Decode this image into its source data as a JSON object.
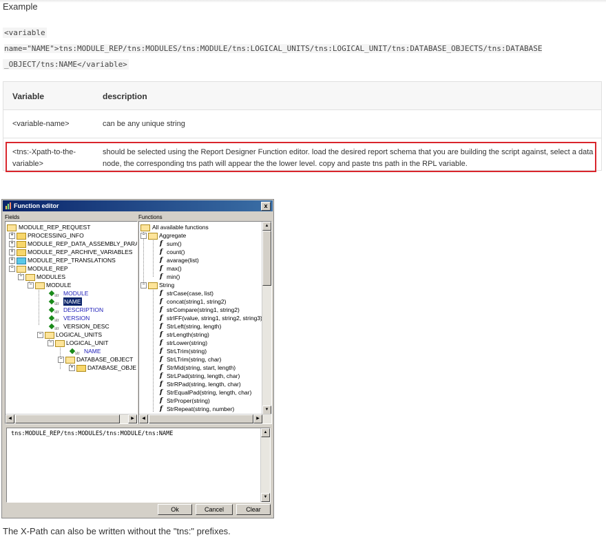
{
  "heading": "Example",
  "code_lines": [
    "<variable",
    "name=\"NAME\">tns:MODULE_REP/tns:MODULES/tns:MODULE/tns:LOGICAL_UNITS/tns:LOGICAL_UNIT/tns:DATABASE_OBJECTS/tns:DATABASE",
    "_OBJECT/tns:NAME</variable>"
  ],
  "table": {
    "headers": [
      "Variable",
      "description"
    ],
    "rows": [
      [
        "<variable-name>",
        "can be any unique string"
      ],
      [
        "<tns:-Xpath-to-the-variable>",
        "should be selected using the Report Designer Function editor. load the desired report schema that you are building the script against, select a data node, the corresponding tns path will appear the the lower level. copy and paste tns path in the RPL variable."
      ]
    ],
    "highlight_color": "#d9252c"
  },
  "editor": {
    "title": "Function editor",
    "close_label": "x",
    "fields_label": "Fields",
    "functions_label": "Functions",
    "fields_tree": [
      "MODULE_REP_REQUEST",
      "PROCESSING_INFO",
      "MODULE_REP_DATA_ASSEMBLY_PARA",
      "MODULE_REP_ARCHIVE_VARIABLES",
      "MODULE_REP_TRANSLATIONS",
      "MODULE_REP",
      "MODULES",
      "MODULE",
      "MODULE",
      "NAME",
      "DESCRIPTION",
      "VERSION",
      "VERSION_DESC",
      "LOGICAL_UNITS",
      "LOGICAL_UNIT",
      "NAME",
      "DATABASE_OBJECT",
      "DATABASE_OBJE"
    ],
    "functions_tree": [
      "All available functions",
      "Aggregate",
      "sum()",
      "count()",
      "avarage(list)",
      "max()",
      "min()",
      "String",
      "strCase(case, list)",
      "concat(string1, string2)",
      "strCompare(string1, string2)",
      "strIFF(value, string1, string2, string3)",
      "StrLeft(string, length)",
      "strLength(string)",
      "strLower(string)",
      "StrLTrim(string)",
      "StrLTrim(string, char)",
      "StrMid(string, start, length)",
      "StrLPad(string, length, char)",
      "StrRPad(string, length, char)",
      "StrEqualPad(string, length, char)",
      "StrProper(string)",
      "StrRepeat(string, number)"
    ],
    "expression": "tns:MODULE_REP/tns:MODULES/tns:MODULE/tns:NAME",
    "buttons": {
      "ok": "Ok",
      "cancel": "Cancel",
      "clear": "Clear"
    },
    "colors": {
      "title_bar": "#0a246a",
      "selection": "#0a246a",
      "leaf_text": "#1c1cb8"
    }
  },
  "footer": "The X-Path can also be written without the \"tns:\" prefixes."
}
